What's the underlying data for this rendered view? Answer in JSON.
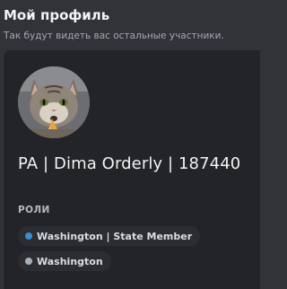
{
  "header": {
    "title": "Мой профиль",
    "subtitle": "Так будут видеть вас остальные участники."
  },
  "profile": {
    "avatar_icon": "cat-avatar-icon",
    "username": "PA | Dima Orderly | 187440",
    "roles_label": "РОЛИ",
    "roles": [
      {
        "name": "Washington | State Member",
        "color": "#3a8fd0"
      },
      {
        "name": "Washington",
        "color": "#a5b0b8"
      }
    ]
  }
}
